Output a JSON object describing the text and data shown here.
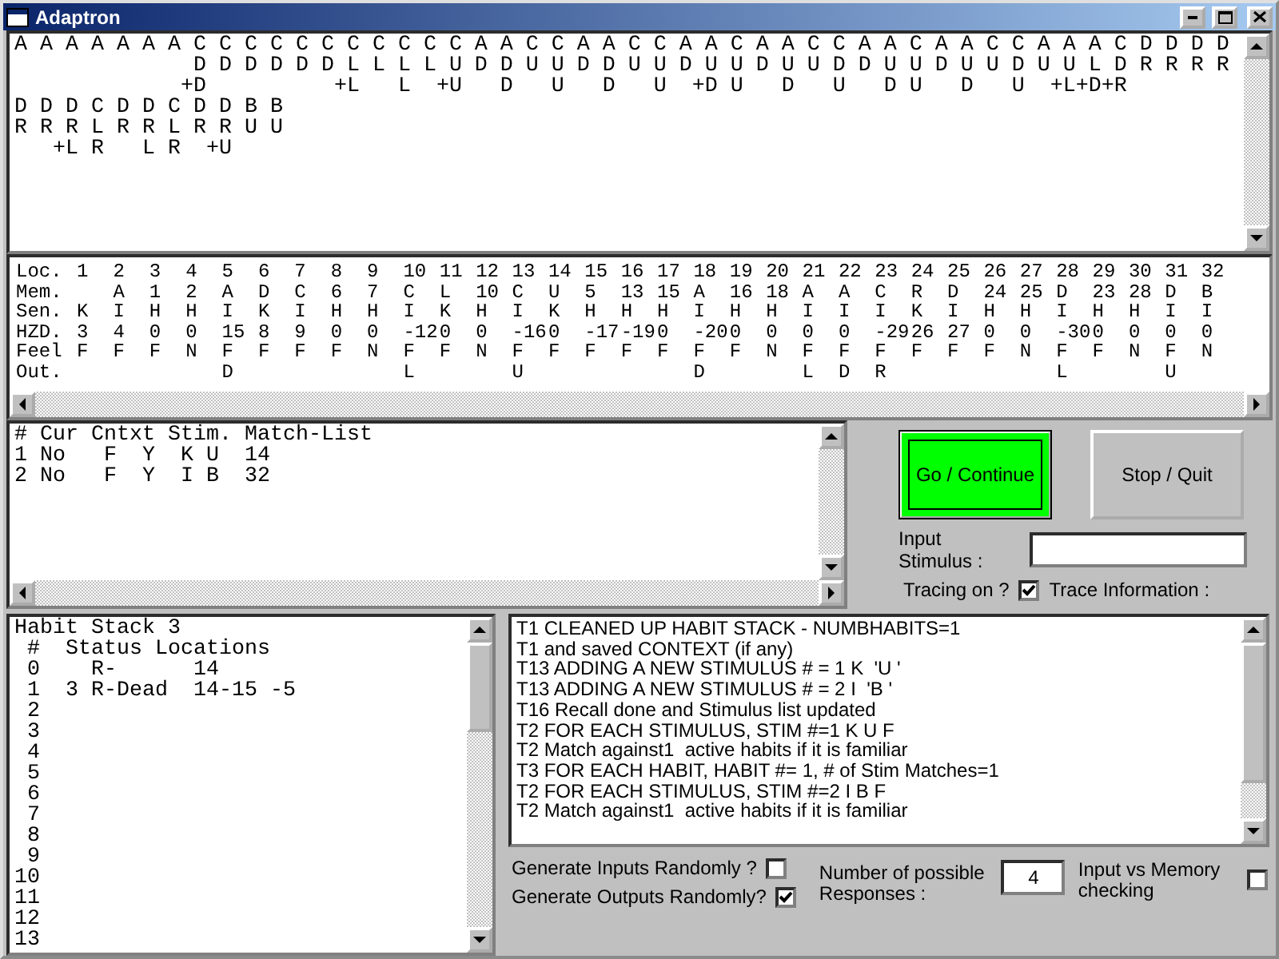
{
  "window": {
    "title": "Adaptron"
  },
  "sense_log": {
    "lines": [
      "A A A A A A A C C C C C C C C C C C A A C C A A C C A A C A A C C A A C A A C C A A A C D D D D",
      "              D D D D D D L L L L U D D U U D D U U D U U D U U D D U U D U U D U U L D R R R R",
      "             +D          +L   L  +U   D   U   D   U  +D U   D   U   D U   D   U  +L+D+R",
      "D D D C D D C D D B B",
      "R R R L R R L R R U U",
      "   +L R   L R  +U"
    ]
  },
  "memory_table": {
    "row_labels": [
      "Loc.",
      "Mem.",
      "Sen.",
      "HZD.",
      "Feel",
      "Out."
    ],
    "locations": [
      {
        "loc": "1",
        "sen": "K",
        "hzd": "3",
        "feel": "F"
      },
      {
        "loc": "2",
        "mem": "A",
        "sen": "I",
        "hzd": "4",
        "feel": "F"
      },
      {
        "loc": "3",
        "mem": "1",
        "sen": "H",
        "hzd": "0",
        "feel": "F"
      },
      {
        "loc": "4",
        "mem": "2",
        "sen": "H",
        "hzd": "0",
        "feel": "N"
      },
      {
        "loc": "5",
        "mem": "A",
        "sen": "I",
        "hzd": "15",
        "feel": "F",
        "out": "D"
      },
      {
        "loc": "6",
        "mem": "D",
        "sen": "K",
        "hzd": "8",
        "feel": "F"
      },
      {
        "loc": "7",
        "mem": "C",
        "sen": "I",
        "hzd": "9",
        "feel": "F"
      },
      {
        "loc": "8",
        "mem": "6",
        "sen": "H",
        "hzd": "0",
        "feel": "F"
      },
      {
        "loc": "9",
        "mem": "7",
        "sen": "H",
        "hzd": "0",
        "feel": "N"
      },
      {
        "loc": "10",
        "mem": "C",
        "sen": "I",
        "hzd": "-12",
        "feel": "F",
        "out": "L"
      },
      {
        "loc": "11",
        "mem": "L",
        "sen": "K",
        "hzd": "0",
        "feel": "F"
      },
      {
        "loc": "12",
        "mem": "10",
        "sen": "H",
        "hzd": "0",
        "feel": "N"
      },
      {
        "loc": "13",
        "mem": "C",
        "sen": "I",
        "hzd": "-16",
        "feel": "F",
        "out": "U"
      },
      {
        "loc": "14",
        "mem": "U",
        "sen": "K",
        "hzd": "0",
        "feel": "F"
      },
      {
        "loc": "15",
        "mem": "5",
        "sen": "H",
        "hzd": "-17",
        "feel": "F"
      },
      {
        "loc": "16",
        "mem": "13",
        "sen": "H",
        "hzd": "-19",
        "feel": "F"
      },
      {
        "loc": "17",
        "mem": "15",
        "sen": "H",
        "hzd": "0",
        "feel": "F"
      },
      {
        "loc": "18",
        "mem": "A",
        "sen": "I",
        "hzd": "-20",
        "feel": "F",
        "out": "D"
      },
      {
        "loc": "19",
        "mem": "16",
        "sen": "H",
        "hzd": "0",
        "feel": "F"
      },
      {
        "loc": "20",
        "mem": "18",
        "sen": "H",
        "hzd": "0",
        "feel": "N"
      },
      {
        "loc": "21",
        "mem": "A",
        "sen": "I",
        "hzd": "0",
        "feel": "F",
        "out": "L"
      },
      {
        "loc": "22",
        "mem": "A",
        "sen": "I",
        "hzd": "0",
        "feel": "F",
        "out": "D"
      },
      {
        "loc": "23",
        "mem": "C",
        "sen": "I",
        "hzd": "-29",
        "feel": "F",
        "out": "R"
      },
      {
        "loc": "24",
        "mem": "R",
        "sen": "K",
        "hzd": "26",
        "feel": "F"
      },
      {
        "loc": "25",
        "mem": "D",
        "sen": "I",
        "hzd": "27",
        "feel": "F"
      },
      {
        "loc": "26",
        "mem": "24",
        "sen": "H",
        "hzd": "0",
        "feel": "F"
      },
      {
        "loc": "27",
        "mem": "25",
        "sen": "H",
        "hzd": "0",
        "feel": "N"
      },
      {
        "loc": "28",
        "mem": "D",
        "sen": "I",
        "hzd": "-30",
        "feel": "F",
        "out": "L"
      },
      {
        "loc": "29",
        "mem": "23",
        "sen": "H",
        "hzd": "0",
        "feel": "F"
      },
      {
        "loc": "30",
        "mem": "28",
        "sen": "H",
        "hzd": "0",
        "feel": "N"
      },
      {
        "loc": "31",
        "mem": "D",
        "sen": "I",
        "hzd": "0",
        "feel": "F",
        "out": "U"
      },
      {
        "loc": "32",
        "mem": "B",
        "sen": "I",
        "hzd": "0",
        "feel": "N"
      }
    ]
  },
  "match_list": {
    "lines": [
      "# Cur Cntxt Stim. Match-List",
      "1 No   F  Y  K U  14",
      "2 No   F  Y  I B  32"
    ]
  },
  "controls": {
    "go_button": {
      "label": "Go / Continue",
      "focused": true
    },
    "stop_button": {
      "label": "Stop / Quit",
      "focused": false
    },
    "input_stimulus": {
      "label": "Input Stimulus :"
    },
    "tracing": {
      "label": "Tracing on ?",
      "checked": true,
      "info_label": "Trace Information :"
    }
  },
  "habit_stack": {
    "lines": [
      "Habit Stack 3",
      " #  Status Locations",
      " 0    R-      14",
      " 1  3 R-Dead  14-15 -5",
      " 2",
      " 3",
      " 4",
      " 5",
      " 6",
      " 7",
      " 8",
      " 9",
      "10",
      "11",
      "12",
      "13"
    ]
  },
  "trace_log": {
    "lines": [
      "T1 CLEANED UP HABIT STACK - NUMBHABITS=1",
      "T1 and saved CONTEXT (if any)",
      "T13 ADDING A NEW STIMULUS # = 1 K  'U '",
      "T13 ADDING A NEW STIMULUS # = 2 I  'B '",
      "T16 Recall done and Stimulus list updated",
      "T2 FOR EACH STIMULUS, STIM #=1 K U F",
      "T2 Match against1  active habits if it is familiar",
      "T3 FOR EACH HABIT, HABIT #= 1, # of Stim Matches=1",
      "T2 FOR EACH STIMULUS, STIM #=2 I B F",
      "T2 Match against1  active habits if it is familiar"
    ]
  },
  "options": {
    "generate_inputs": {
      "label": "Generate Inputs Randomly ?",
      "checked": false
    },
    "generate_outputs": {
      "label": "Generate Outputs Randomly?",
      "checked": true
    },
    "responses": {
      "label": "Number of possible Responses :",
      "value": "4"
    },
    "memory_checking": {
      "label": "Input vs Memory checking",
      "checked": false
    }
  }
}
